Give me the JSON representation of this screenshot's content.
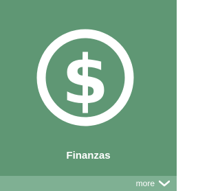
{
  "tile": {
    "title": "Finanzas",
    "icon": "dollar-circle-icon",
    "background_color": "#5f9774",
    "footer_color": "#7fb093",
    "text_color": "#ffffff"
  },
  "footer": {
    "more_label": "more",
    "more_icon": "chevron-down-icon"
  }
}
